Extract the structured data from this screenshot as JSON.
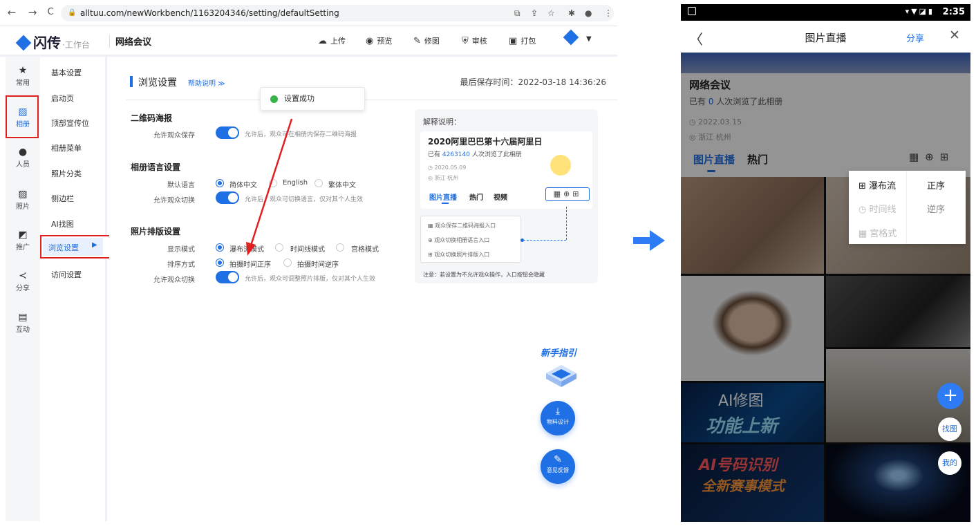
{
  "browser": {
    "url": "alltuu.com/newWorkbench/1163204346/setting/defaultSetting",
    "nav": {
      "back": "←",
      "forward": "→",
      "reload": "C"
    }
  },
  "app": {
    "logo": "闪传",
    "logo_sub": "·工作台",
    "title": "网络会议",
    "actions": [
      {
        "icon": "upload-icon",
        "glyph": "☁",
        "label": "上传"
      },
      {
        "icon": "eye-icon",
        "glyph": "◉",
        "label": "预览"
      },
      {
        "icon": "brush-icon",
        "glyph": "✎",
        "label": "修图"
      },
      {
        "icon": "shield-icon",
        "glyph": "⛨",
        "label": "审核"
      },
      {
        "icon": "package-icon",
        "glyph": "▣",
        "label": "打包"
      }
    ],
    "caret": "▼"
  },
  "iconbar": [
    {
      "label": "常用",
      "glyph": "★",
      "icon": "star-icon"
    },
    {
      "label": "相册",
      "glyph": "▨",
      "icon": "album-icon",
      "active": true
    },
    {
      "label": "人员",
      "glyph": "●",
      "icon": "person-icon"
    },
    {
      "label": "照片",
      "glyph": "▨",
      "icon": "photo-icon"
    },
    {
      "label": "推广",
      "glyph": "◩",
      "icon": "promote-icon"
    },
    {
      "label": "分享",
      "glyph": "≺",
      "icon": "share-icon"
    },
    {
      "label": "互动",
      "glyph": "▤",
      "icon": "chat-icon"
    }
  ],
  "menu": [
    "基本设置",
    "启动页",
    "顶部宣传位",
    "相册菜单",
    "照片分类",
    "侧边栏",
    "AI找图",
    "浏览设置",
    "访问设置"
  ],
  "menu_active": "浏览设置",
  "content": {
    "section_title": "浏览设置",
    "help_link": "帮助说明 ≫",
    "last_saved_label": "最后保存时间：",
    "last_saved": "2022-03-18 14:36:26",
    "toast": "设置成功",
    "qr": {
      "title": "二维码海报",
      "allow_label": "允许观众保存",
      "allow_hint": "允许后，观众可在相册内保存二维码海报"
    },
    "lang": {
      "title": "相册语言设置",
      "default_label": "默认语言",
      "options": [
        "简体中文",
        "English",
        "繁体中文"
      ],
      "switch_label": "允许观众切换",
      "switch_hint": "允许后，观众可切换语言，仅对其个人生效"
    },
    "layout": {
      "title": "照片排版设置",
      "mode_label": "显示模式",
      "modes": [
        "瀑布流模式",
        "时间线模式",
        "宫格模式"
      ],
      "sort_label": "排序方式",
      "sorts": [
        "拍摄时间正序",
        "拍摄时间逆序"
      ],
      "switch_label": "允许观众切换",
      "switch_hint": "允许后，观众可调整照片排版，仅对其个人生效"
    },
    "explain": {
      "title": "解释说明：",
      "album_name": "2020阿里巴巴第十六届阿里日",
      "viewed_prefix": "已有 ",
      "viewed_count": "4263140",
      "viewed_suffix": " 人次浏览了此相册",
      "date": "◷ 2020.05.09",
      "place": "◎ 浙江 杭州",
      "tabs": [
        "图片直播",
        "热门",
        "视频"
      ],
      "icons": "▦⊕⊞",
      "list": [
        "▦ 观众保存二维码海报入口",
        "⊕ 观众切换相册语言入口",
        "⊞ 观众切换照片排版入口"
      ],
      "note": "注意：若设置为不允许观众操作，入口按钮会隐藏"
    },
    "guide": "新手指引",
    "fab_material": "物料设计",
    "fab_feedback": "意见反馈"
  },
  "phone": {
    "time": "2:35",
    "status_icons": "▾▼◪▮",
    "title": "图片直播",
    "share": "分享",
    "back": "〈",
    "close": "✕",
    "album_name": "网络会议",
    "views_prefix": "已有 ",
    "views_count": "0",
    "views_suffix": " 人次浏览了此相册",
    "date": "◷ 2022.03.15",
    "place": "◎ 浙江 杭州",
    "tabs": [
      "图片直播",
      "热门"
    ],
    "icons": "▦⊕⊞",
    "popup": {
      "layouts": [
        "⊞ 瀑布流",
        "◷ 时间线",
        "▦ 宫格式"
      ],
      "orders": [
        "正序",
        "逆序"
      ]
    },
    "banner1": "AI修图",
    "banner1b": "功能上新",
    "banner2": "AI号码识别",
    "banner2b": "全新赛事模式",
    "fab_plus": "+",
    "fab_find": "找图",
    "fab_mine": "我的"
  },
  "colors": {
    "accent": "#1f6fe5",
    "highlight_box": "#e02020",
    "toast_ok": "#37b34a"
  }
}
